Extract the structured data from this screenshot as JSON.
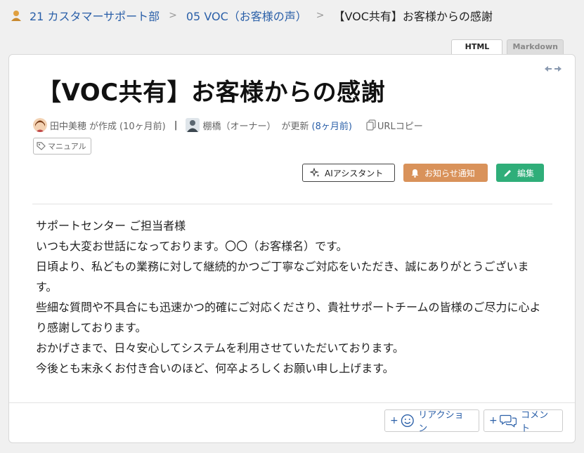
{
  "breadcrumb": {
    "items": [
      "21 カスタマーサポート部",
      "05 VOC（お客様の声）"
    ],
    "current": "【VOC共有】お客様からの感謝"
  },
  "tabs": {
    "html": "HTML",
    "markdown": "Markdown"
  },
  "page": {
    "title": "【VOC共有】お客様からの感謝",
    "author": "田中美穂",
    "created_label": "が作成",
    "created_time": "(10ヶ月前)",
    "separator": "|",
    "updater": "棚橋（オーナー）",
    "updated_label": "が更新",
    "updated_time": "(8ヶ月前)",
    "copy_url": "URLコピー",
    "tag": "マニュアル"
  },
  "actions": {
    "ai": "AIアシスタント",
    "notify": "お知らせ通知",
    "edit": "編集"
  },
  "body": [
    "サポートセンター ご担当者様",
    "いつも大変お世話になっております。〇〇（お客様名）です。",
    "日頃より、私どもの業務に対して継続的かつご丁寧なご対応をいただき、誠にありがとうございます。",
    "些細な質問や不具合にも迅速かつ的確にご対応くださり、貴社サポートチームの皆様のご尽力に心より感謝しております。",
    "おかげさまで、日々安心してシステムを利用させていただいております。",
    "今後とも末永くお付き合いのほど、何卒よろしくお願い申し上げます。"
  ],
  "reactions": {
    "plus": "+",
    "reaction": "リアクション",
    "comment": "コメント"
  },
  "colors": {
    "link": "#2a5fa8",
    "notify": "#d9925a",
    "edit": "#2fae79"
  }
}
